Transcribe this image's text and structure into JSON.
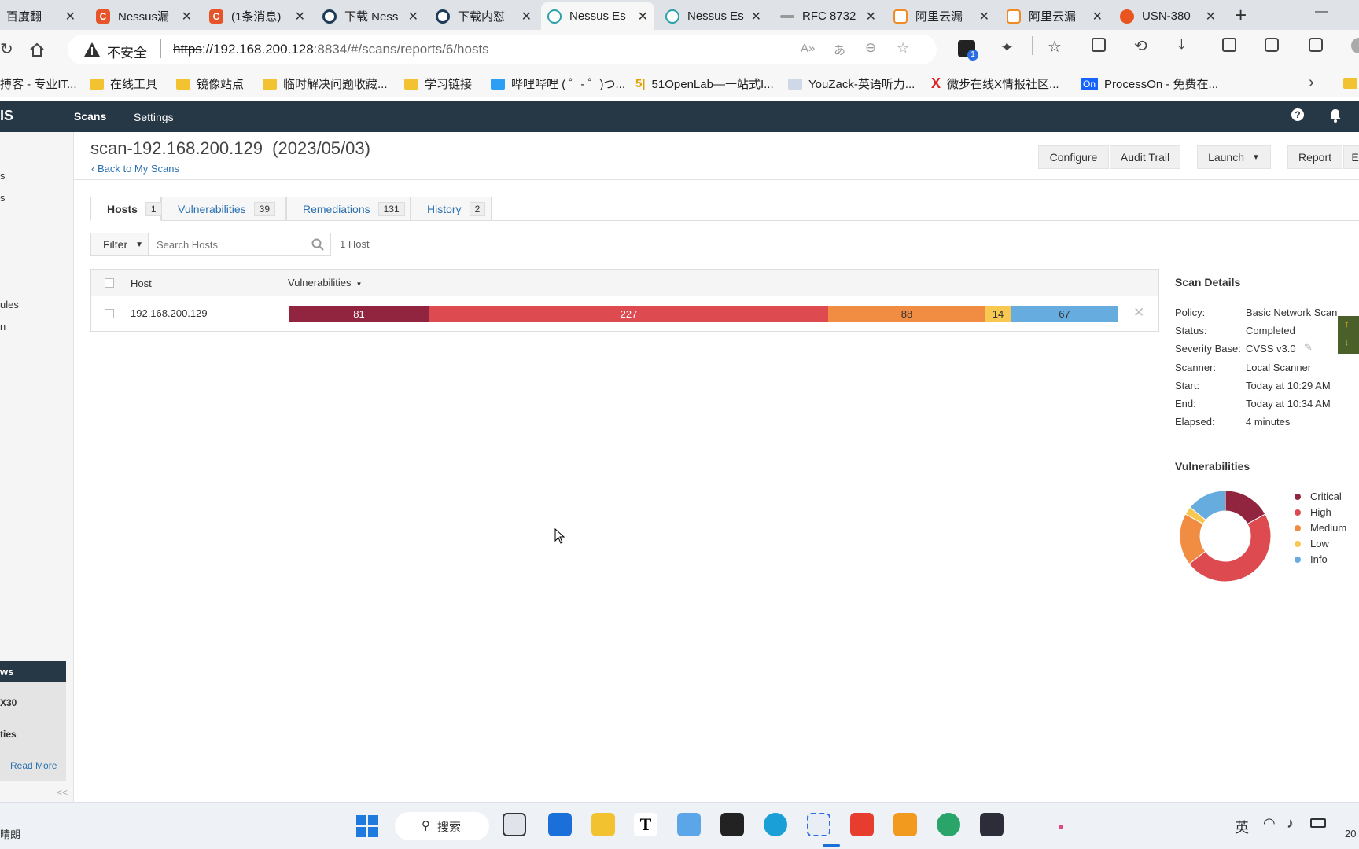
{
  "browser": {
    "tabs": [
      {
        "label": "百度翻译",
        "icon_color": "#2b6de5"
      },
      {
        "label": "Nessus漏",
        "icon_color": "#e8542a"
      },
      {
        "label": "(1条消息)",
        "icon_color": "#e8542a"
      },
      {
        "label": "下载 Ness",
        "icon_color": "#1f3b57"
      },
      {
        "label": "下载内怼",
        "icon_color": "#1f3b57"
      },
      {
        "label": "Nessus Es",
        "icon_color": "#2aa0a8"
      },
      {
        "label": "Nessus Es",
        "icon_color": "#2aa0a8"
      },
      {
        "label": "RFC 8732",
        "icon_color": "#888888"
      },
      {
        "label": "阿里云漏",
        "icon_color": "#f08a24"
      },
      {
        "label": "阿里云漏",
        "icon_color": "#f08a24"
      },
      {
        "label": "USN-380",
        "icon_color": "#e95420"
      }
    ],
    "new_tab": "+",
    "minimize": "—",
    "insecure_label": "不安全",
    "url_scheme": "https",
    "url_host": "://192.168.200.128",
    "url_rest": ":8834/#/scans/reports/6/hosts",
    "ext_badge": "1",
    "bookmarks": [
      "搏客 - 专业IT...",
      "在线工具",
      "镜像站点",
      "临时解决问题收藏...",
      "学习链接",
      "哔哩哔哩 ( ゜- ゜)つ...",
      "51OpenLab—一站式I...",
      "YouZack-英语听力...",
      "微步在线X情报社区...",
      "ProcessOn - 免费在..."
    ]
  },
  "nessus": {
    "logo_fragment": "IS",
    "nav": [
      "Scans",
      "Settings"
    ],
    "sidebar_fragments": [
      "s",
      "s",
      "ules",
      "n"
    ],
    "news": {
      "header": "ws",
      "items": [
        "X30",
        "ties"
      ],
      "read_more": "Read More"
    },
    "collapse": "<<",
    "scan_title": "scan-192.168.200.129  (2023/05/03)",
    "back_link": "Back to My Scans",
    "buttons": [
      "Configure",
      "Audit Trail",
      "Launch",
      "Report"
    ],
    "tabs": [
      {
        "label": "Hosts",
        "count": "1"
      },
      {
        "label": "Vulnerabilities",
        "count": "39"
      },
      {
        "label": "Remediations",
        "count": "131"
      },
      {
        "label": "History",
        "count": "2"
      }
    ],
    "filter_label": "Filter",
    "search_placeholder": "Search Hosts",
    "host_count": "1 Host",
    "table": {
      "col_host": "Host",
      "col_vulns": "Vulnerabilities",
      "rows": [
        {
          "host": "192.168.200.129",
          "critical": "81",
          "high": "227",
          "medium": "88",
          "low": "14",
          "info": "67"
        }
      ]
    },
    "details": {
      "title": "Scan Details",
      "rows": [
        {
          "label": "Policy:",
          "value": "Basic Network Scan"
        },
        {
          "label": "Status:",
          "value": "Completed"
        },
        {
          "label": "Severity Base:",
          "value": "CVSS v3.0"
        },
        {
          "label": "Scanner:",
          "value": "Local Scanner"
        },
        {
          "label": "Start:",
          "value": "Today at 10:29 AM"
        },
        {
          "label": "End:",
          "value": "Today at 10:34 AM"
        },
        {
          "label": "Elapsed:",
          "value": "4 minutes"
        }
      ]
    },
    "vuln_title": "Vulnerabilities",
    "legend": [
      {
        "name": "Critical",
        "color": "#91243e"
      },
      {
        "name": "High",
        "color": "#dd4b50"
      },
      {
        "name": "Medium",
        "color": "#f18c43"
      },
      {
        "name": "Low",
        "color": "#f8c851"
      },
      {
        "name": "Info",
        "color": "#67acdf"
      }
    ]
  },
  "taskbar": {
    "weather": "晴朗",
    "search_label": "搜索",
    "ime": "英",
    "clock_fragment": "20"
  }
}
